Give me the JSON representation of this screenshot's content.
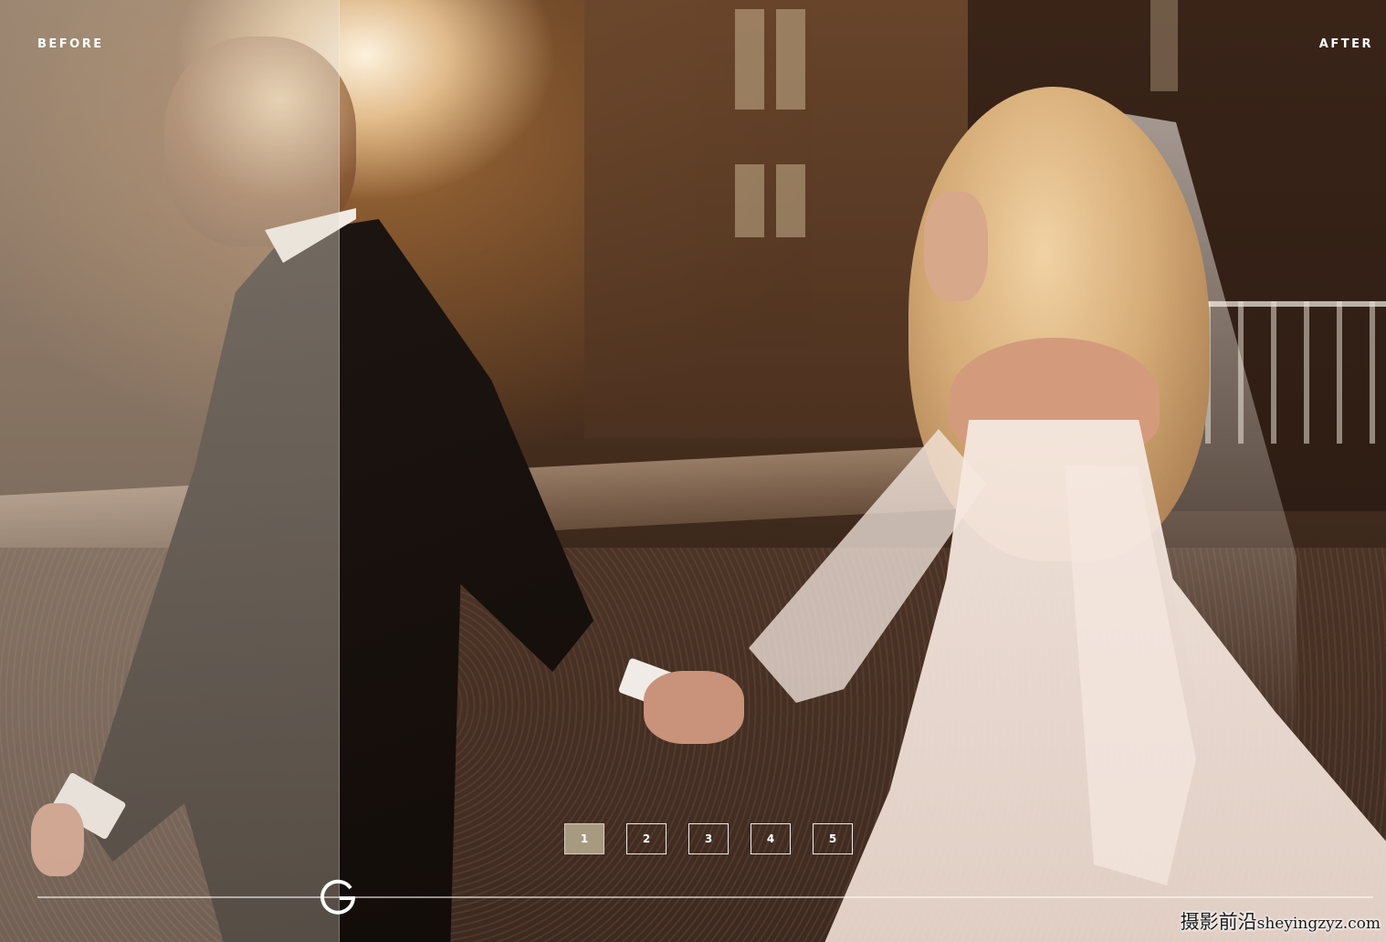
{
  "labels": {
    "before": "BEFORE",
    "after": "AFTER"
  },
  "pager": {
    "pages": [
      "1",
      "2",
      "3",
      "4",
      "5"
    ],
    "active": "1"
  },
  "slider": {
    "handle_icon": "g-logo-icon",
    "position": 0.225
  },
  "watermark": {
    "cn": "摄影前沿",
    "en": "sheyingzyz.com"
  },
  "colors": {
    "active_page_bg": "#a89a80",
    "label_text": "#ffffff"
  }
}
